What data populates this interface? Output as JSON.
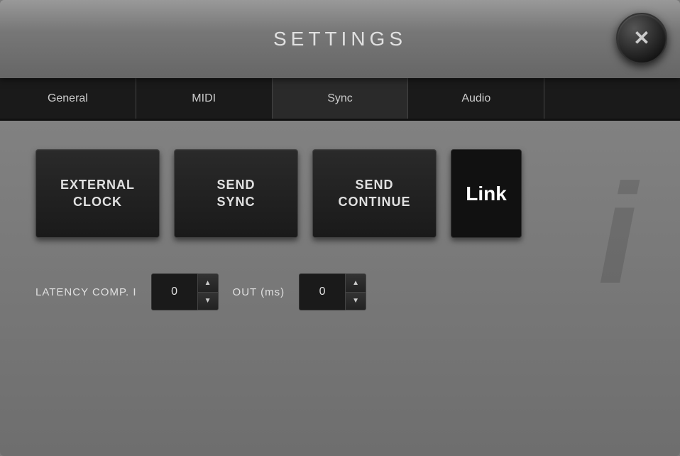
{
  "header": {
    "title": "SETTINGS",
    "close_label": "✕"
  },
  "tabs": [
    {
      "id": "general",
      "label": "General"
    },
    {
      "id": "midi",
      "label": "MIDI"
    },
    {
      "id": "sync",
      "label": "Sync"
    },
    {
      "id": "audio",
      "label": "Audio"
    },
    {
      "id": "extra",
      "label": ""
    }
  ],
  "buttons": [
    {
      "id": "external-clock",
      "label": "EXTERNAL\nCLOCK"
    },
    {
      "id": "send-sync",
      "label": "SEND\nSYNC"
    },
    {
      "id": "send-continue",
      "label": "SEND\nCONTINUE"
    }
  ],
  "link_button": {
    "label": "Link"
  },
  "latency": {
    "label": "LATENCY COMP. I",
    "value": "0"
  },
  "out": {
    "label": "OUT (ms)",
    "value": "0"
  },
  "watermark": "i"
}
